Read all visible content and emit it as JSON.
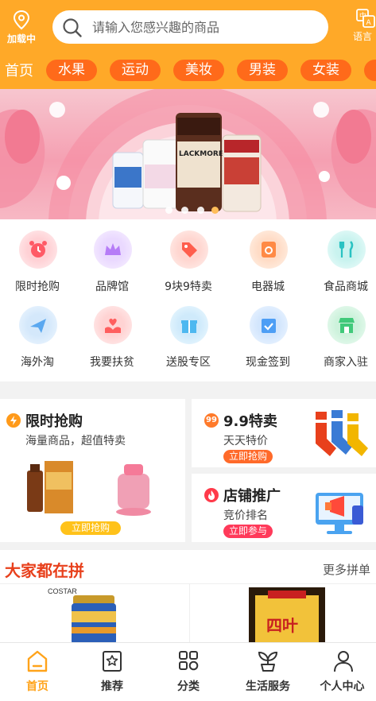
{
  "header": {
    "location_label": "加载中",
    "search_placeholder": "请输入您感兴趣的商品",
    "language_label": "语言",
    "home_tab": "首页",
    "category_tabs": [
      "水果",
      "运动",
      "美妆",
      "男装",
      "女装"
    ]
  },
  "banner": {
    "product_label": "LACKMORES"
  },
  "categories": [
    {
      "label": "限时抢购",
      "icon": "alarm-clock-icon",
      "color": "#ff5a66"
    },
    {
      "label": "品牌馆",
      "icon": "crown-icon",
      "color": "#b67cf7"
    },
    {
      "label": "9块9特卖",
      "icon": "price-tag-icon",
      "color": "#ff5e4d"
    },
    {
      "label": "电器城",
      "icon": "appliance-icon",
      "color": "#ff8a45"
    },
    {
      "label": "食品商城",
      "icon": "fork-knife-icon",
      "color": "#29c2c2"
    },
    {
      "label": "海外淘",
      "icon": "airplane-icon",
      "color": "#5aa8f0"
    },
    {
      "label": "我要扶贫",
      "icon": "helping-hands-icon",
      "color": "#ff5e5e"
    },
    {
      "label": "送股专区",
      "icon": "gift-icon",
      "color": "#4db8f0"
    },
    {
      "label": "现金签到",
      "icon": "calendar-check-icon",
      "color": "#4d9ef5"
    },
    {
      "label": "商家入驻",
      "icon": "storefront-icon",
      "color": "#40c97a"
    }
  ],
  "promos": {
    "flash": {
      "title": "限时抢购",
      "subtitle": "海量商品，超值特卖",
      "button": "立即抢购"
    },
    "nine": {
      "badge": "99",
      "title": "9.9特卖",
      "subtitle": "天天特价",
      "button": "立即抢购"
    },
    "shop": {
      "title": "店铺推广",
      "subtitle": "竞价排名",
      "button": "立即参与"
    }
  },
  "group_buy": {
    "title": "大家都在拼",
    "more": "更多拼单",
    "item1_brand": "COSTAR",
    "item2_text": "四叶"
  },
  "bottom_nav": [
    {
      "label": "首页",
      "icon": "home-icon",
      "active": true
    },
    {
      "label": "推荐",
      "icon": "star-book-icon",
      "active": false
    },
    {
      "label": "分类",
      "icon": "grid-icon",
      "active": false
    },
    {
      "label": "生活服务",
      "icon": "sprout-icon",
      "active": false
    },
    {
      "label": "个人中心",
      "icon": "user-icon",
      "active": false
    }
  ],
  "colors": {
    "brand": "#ffa928",
    "tab_pill": "#ff6a1a",
    "accent_red": "#e8401c",
    "active_nav": "#ffa31a"
  }
}
